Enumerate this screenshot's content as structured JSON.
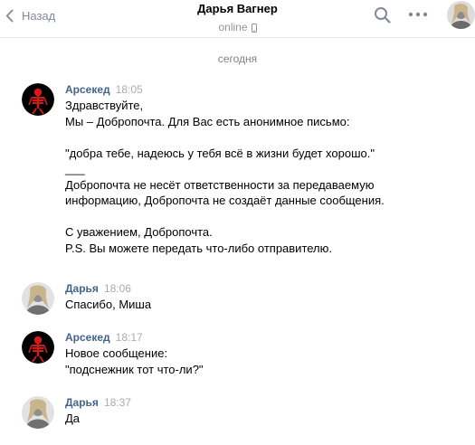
{
  "header": {
    "back_label": "Назад",
    "title": "Дарья Вагнер",
    "status": "online"
  },
  "icons": {
    "back": "chevron-left-icon",
    "search": "search-icon",
    "more": "more-horizontal-icon",
    "mobile": "mobile-phone-icon"
  },
  "colors": {
    "author": "#42648b",
    "muted": "#828a99",
    "divider": "#e7e8ec"
  },
  "date_divider": "сегодня",
  "messages": [
    {
      "author": "Арсекед",
      "time": "18:05",
      "lines": [
        "Здравствуйте,",
        "Мы – Добропочта. Для Вас есть анонимное письмо:",
        "",
        "\"добра тебе, надеюсь у тебя всё в жизни будет хорошо.\"",
        "___",
        "Добропочта не несёт ответственности за передаваемую",
        "информацию, Добропочта не создаёт данные сообщения.",
        "",
        "С уважением, Добропочта.",
        "P.S. Вы можете передать что-либо отправителю."
      ]
    },
    {
      "author": "Дарья",
      "time": "18:06",
      "lines": [
        "Спасибо, Миша"
      ]
    },
    {
      "author": "Арсекед",
      "time": "18:17",
      "lines": [
        "Новое сообщение:",
        "\"подснежник тот что-ли?\""
      ]
    },
    {
      "author": "Дарья",
      "time": "18:37",
      "lines": [
        "Да"
      ]
    }
  ]
}
